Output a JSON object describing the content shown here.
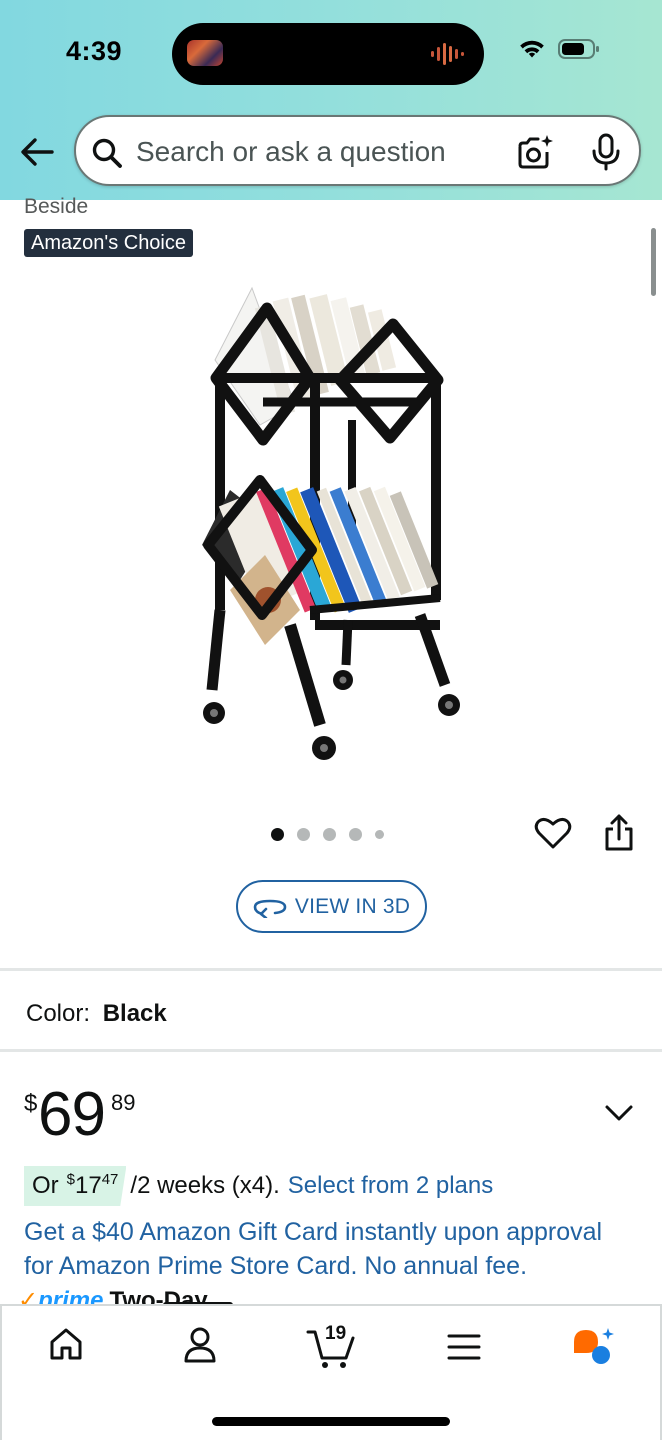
{
  "status_bar": {
    "time": "4:39"
  },
  "search": {
    "placeholder": "Search or ask a question",
    "value": ""
  },
  "product": {
    "title_fragment": "Beside",
    "badge": "Amazon's Choice",
    "image_dots": {
      "count": 5,
      "active_index": 0
    },
    "view_3d_label": "VIEW IN 3D",
    "color_label": "Color:",
    "color_value": "Black"
  },
  "price": {
    "currency_symbol": "$",
    "whole": "69",
    "fraction": "89"
  },
  "installment": {
    "prefix": "Or",
    "currency_symbol": "$",
    "amount_whole": "17",
    "amount_fraction": "47",
    "terms": "/2 weeks (x4).",
    "link": "Select from 2 plans"
  },
  "promo": {
    "text": "Get a $40 Amazon Gift Card instantly upon approval for Amazon Prime Store Card. No annual fee."
  },
  "delivery": {
    "prime_check": "✓",
    "prime_word": "prime",
    "speed": "Two-Day"
  },
  "bottom_nav": {
    "cart_count": "19",
    "items": [
      "home",
      "account",
      "cart",
      "menu",
      "rufus"
    ]
  },
  "colors": {
    "link_blue": "#2162a1",
    "header_gradient_start": "#82d8e0",
    "header_gradient_end": "#a6e6d2",
    "badge_bg": "#232f3e",
    "installment_bg": "#d8f3e6",
    "rufus_orange": "#ff6a00",
    "rufus_blue": "#1a7fe0"
  },
  "icons": [
    "arrow-left-icon",
    "search-icon",
    "camera-icon",
    "microphone-icon",
    "heart-icon",
    "share-icon",
    "rotate-3d-icon",
    "chevron-down-icon",
    "home-icon",
    "account-icon",
    "cart-icon",
    "menu-icon",
    "rufus-icon",
    "wifi-icon",
    "battery-icon"
  ]
}
